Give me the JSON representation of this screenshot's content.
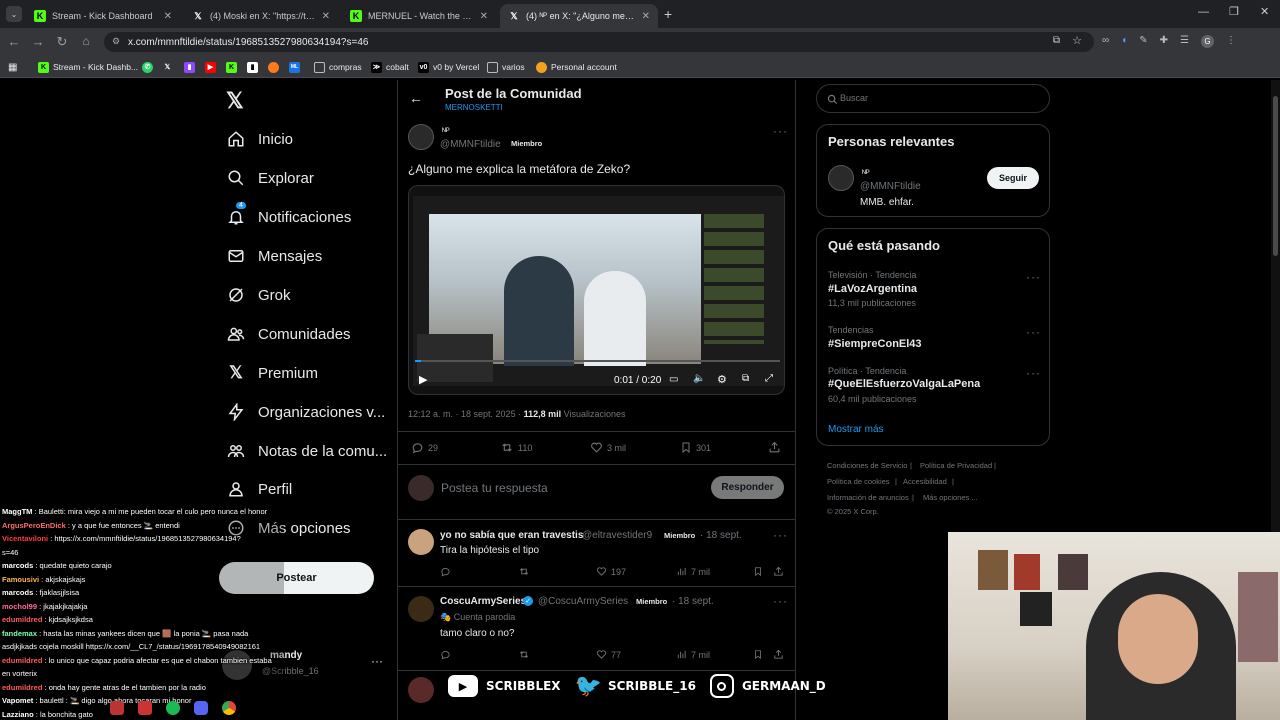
{
  "browser": {
    "tabs": [
      {
        "label": "Stream - Kick Dashboard",
        "icon": "kick-icon",
        "color": "#53fc18"
      },
      {
        "label": "(4) Moski en X: \"https://t.co/Gr",
        "icon": "x-icon",
        "color": "#ffffff"
      },
      {
        "label": "MERNUEL - Watch the VOD on",
        "icon": "kick-icon",
        "color": "#53fc18"
      },
      {
        "label": "(4) ᴺᴾ en X: \"¿Alguno me explic",
        "icon": "x-icon",
        "color": "#ffffff"
      }
    ],
    "url": "x.com/mmnftildie/status/1968513527980634194?s=46",
    "bookmarks": [
      "Stream - Kick Dashb...",
      "compras",
      "cobalt",
      "v0 by Vercel",
      "varios",
      "Personal account"
    ]
  },
  "sidebar": {
    "items": [
      {
        "label": "Inicio",
        "icon": "home-icon"
      },
      {
        "label": "Explorar",
        "icon": "search-icon"
      },
      {
        "label": "Notificaciones",
        "icon": "bell-icon",
        "badge": "4"
      },
      {
        "label": "Mensajes",
        "icon": "mail-icon"
      },
      {
        "label": "Grok",
        "icon": "grok-icon"
      },
      {
        "label": "Comunidades",
        "icon": "people-icon"
      },
      {
        "label": "Premium",
        "icon": "x-logo-icon"
      },
      {
        "label": "Organizaciones v...",
        "icon": "lightning-icon"
      },
      {
        "label": "Notas de la comu...",
        "icon": "notes-icon"
      },
      {
        "label": "Perfil",
        "icon": "person-icon"
      },
      {
        "label": "Más opciones",
        "icon": "more-circle-icon"
      }
    ],
    "post_button": "Postear",
    "account": {
      "name": "mandy",
      "handle": "@Scribble_16"
    }
  },
  "main": {
    "header_title": "Post de la Comunidad",
    "header_sub": "MERNOSKETTI",
    "post": {
      "name": "ᴺᴾ",
      "handle": "@MMNFtildie",
      "role": "Miembro",
      "text": "¿Alguno me explica la metáfora de Zeko?",
      "video_time": "0:01 / 0:20",
      "timestamp": "12:12 a. m. · 18 sept. 2025 · ",
      "views": "112,8 mil",
      "views_label": "Visualizaciones",
      "replies": "29",
      "reposts": "110",
      "likes": "3 mil",
      "bookmarks": "301"
    },
    "reply_placeholder": "Postea tu respuesta",
    "reply_button": "Responder",
    "replies": [
      {
        "name": "yo no sabía que eran travestis",
        "handle": "@eltravestider9",
        "role": "Miembro",
        "date": "· 18 sept.",
        "text": "Tira la hipótesis el tipo",
        "sub": "",
        "likes": "197",
        "views": "7 mil"
      },
      {
        "name": "CoscuArmySeries",
        "handle": "@CoscuArmySeries",
        "role": "Miembro",
        "date": "· 18 sept.",
        "text": "tamo claro o no?",
        "sub": "Cuenta parodia",
        "likes": "77",
        "views": "7 mil"
      }
    ]
  },
  "right": {
    "search_placeholder": "Buscar",
    "relevant_title": "Personas relevantes",
    "relevant_person": {
      "name": "ᴺᴾ",
      "handle": "@MMNFtildie",
      "bio": "MMB. ehfar.",
      "button": "Seguir"
    },
    "trending_title": "Qué está pasando",
    "trends": [
      {
        "meta": "Televisión · Tendencia",
        "tag": "#LaVozArgentina",
        "count": "11,3 mil publicaciones"
      },
      {
        "meta": "Tendencias",
        "tag": "#SiempreConEl43",
        "count": ""
      },
      {
        "meta": "Política · Tendencia",
        "tag": "#QueElEsfuerzoValgaLaPena",
        "count": "60,4 mil publicaciones"
      }
    ],
    "show_more": "Mostrar más",
    "footer": [
      "Condiciones de Servicio",
      "Política de Privacidad",
      "Política de cookies",
      "Accesibilidad",
      "Información de anuncios",
      "Más opciones ...",
      "© 2025 X Corp."
    ]
  },
  "overlay": {
    "chat": [
      {
        "user": "MaggTM",
        "color": "#ffffff",
        "msg": "Bauletti: mira viejo a mi me pueden tocar el culo pero nunca el honor"
      },
      {
        "user": "ArgusPeroEnDick",
        "color": "#ff6b6b",
        "msg": "y a que fue entonces 🚬 entendi"
      },
      {
        "user": "Vicentaviloni",
        "color": "#ff3d3d",
        "msg": "https://x.com/mmnftildie/status/1968513527980634194?"
      },
      {
        "user": "",
        "color": "#ffffff",
        "msg": "s=46"
      },
      {
        "user": "marcods",
        "color": "#ffffff",
        "msg": "quedate quieto carajo"
      },
      {
        "user": "Famousivi",
        "color": "#ffb84d",
        "msg": "akjskajskajs"
      },
      {
        "user": "marcods",
        "color": "#ffffff",
        "msg": "fjaklasjjlsisa"
      },
      {
        "user": "mochol99",
        "color": "#ff6b9d",
        "msg": "jkajakjkajakja"
      },
      {
        "user": "edumildred",
        "color": "#ff5c5c",
        "msg": "kjdsajksjkdsa"
      },
      {
        "user": "fandemax",
        "color": "#7dffb0",
        "msg": "hasta las minas yankees dicen que 🟫 la ponia 🚬 pasa nada"
      },
      {
        "user": "",
        "color": "#ffffff",
        "msg": "asdjkjkads cojela moskill https://x.com/__CL7_/status/1969178540949082161"
      },
      {
        "user": "edumildred",
        "color": "#ff5c5c",
        "msg": "lo unico que capaz podria afectar es que el chabon tambien estaba"
      },
      {
        "user": "",
        "color": "#ffffff",
        "msg": "en vorterix"
      },
      {
        "user": "edumildred",
        "color": "#ff5c5c",
        "msg": "onda hay gente atras de el tambien por la radio"
      },
      {
        "user": "Vapomet",
        "color": "#ffffff",
        "msg": "baulettl : 🚬 digo algo ahora tocaran mi honor"
      },
      {
        "user": "Lazziano",
        "color": "#ffffff",
        "msg": "la bonchita gato"
      }
    ],
    "socials": [
      "SCRIBBLEX",
      "SCRIBBLE_16",
      "GERMAAN_D"
    ]
  }
}
